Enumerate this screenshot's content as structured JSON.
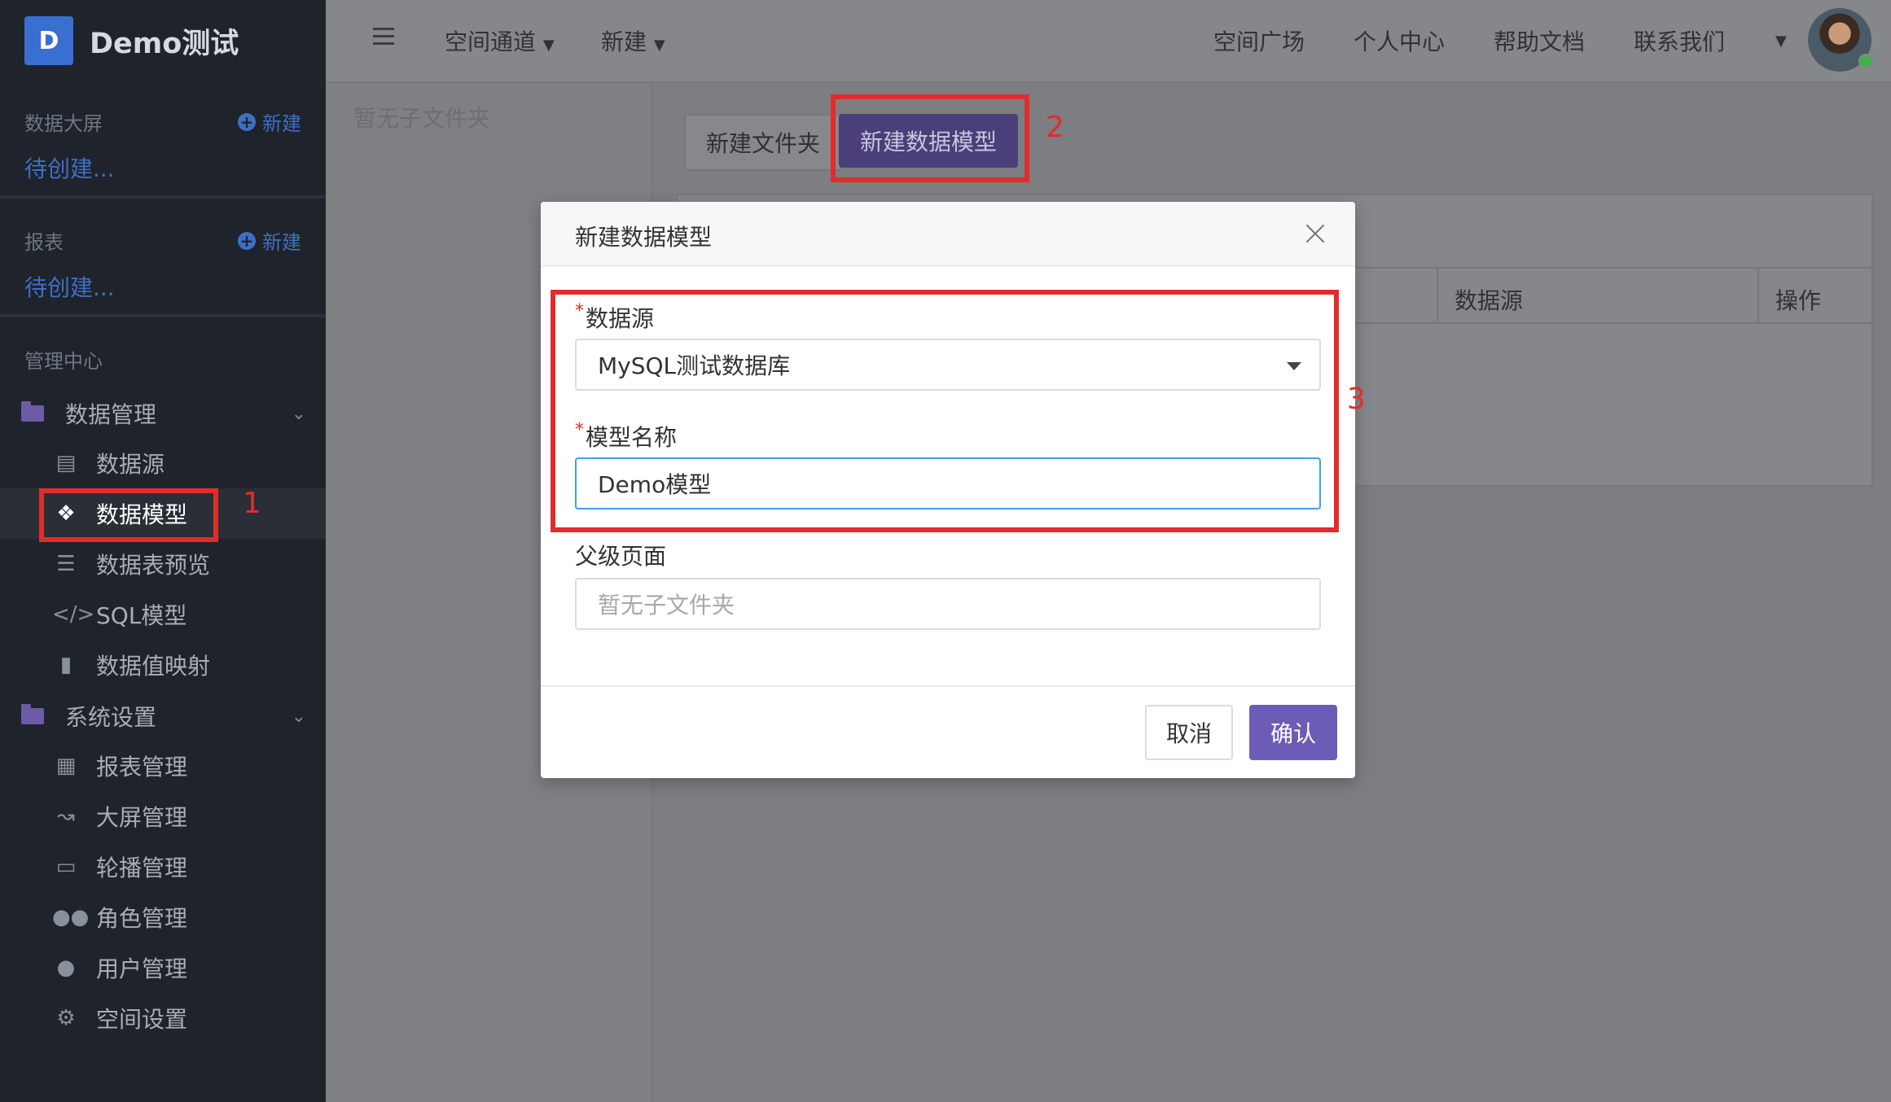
{
  "app": {
    "logo_letter": "D",
    "title": "Demo测试"
  },
  "sidebar": {
    "dashboards": {
      "title": "数据大屏",
      "new_label": "新建",
      "pending": "待创建..."
    },
    "reports": {
      "title": "报表",
      "new_label": "新建",
      "pending": "待创建..."
    },
    "admin_title": "管理中心",
    "data_group": {
      "label": "数据管理",
      "items": [
        {
          "label": "数据源",
          "icon": "database-icon"
        },
        {
          "label": "数据模型",
          "icon": "cubes-icon"
        },
        {
          "label": "数据表预览",
          "icon": "list-icon"
        },
        {
          "label": "SQL模型",
          "icon": "code-icon"
        },
        {
          "label": "数据值映射",
          "icon": "book-icon"
        }
      ]
    },
    "system_group": {
      "label": "系统设置",
      "items": [
        {
          "label": "报表管理",
          "icon": "grid-icon"
        },
        {
          "label": "大屏管理",
          "icon": "chart-line-icon"
        },
        {
          "label": "轮播管理",
          "icon": "monitor-icon"
        },
        {
          "label": "角色管理",
          "icon": "users-icon"
        },
        {
          "label": "用户管理",
          "icon": "user-icon"
        },
        {
          "label": "空间设置",
          "icon": "gear-icon"
        }
      ]
    }
  },
  "header": {
    "space_channel": "空间通道",
    "new_menu": "新建",
    "links": [
      "空间广场",
      "个人中心",
      "帮助文档",
      "联系我们"
    ]
  },
  "page": {
    "folder_empty": "暂无子文件夹",
    "new_folder_button": "新建文件夹",
    "new_model_button": "新建数据模型",
    "table_headers": {
      "datasource": "数据源",
      "actions": "操作"
    }
  },
  "modal": {
    "title": "新建数据模型",
    "datasource": {
      "label": "数据源",
      "value": "MySQL测试数据库"
    },
    "model_name": {
      "label": "模型名称",
      "value": "Demo模型"
    },
    "parent_page": {
      "label": "父级页面",
      "placeholder": "暂无子文件夹"
    },
    "cancel": "取消",
    "confirm": "确认"
  },
  "annotations": [
    "1",
    "2",
    "3"
  ],
  "colors": {
    "accent": "#6d5bb8",
    "annotation": "#e22c2c",
    "link": "#3f6fc2"
  }
}
